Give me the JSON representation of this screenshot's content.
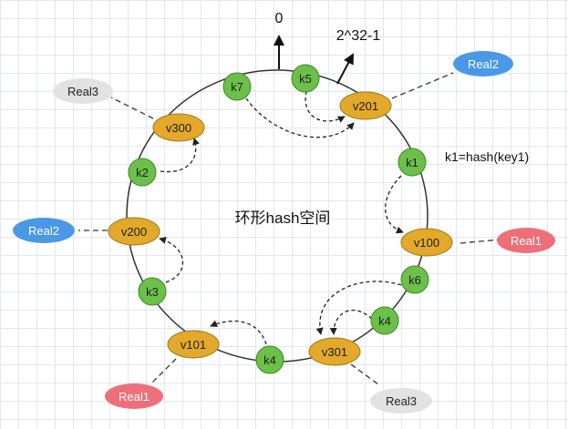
{
  "colors": {
    "key_fill": "#6cc04a",
    "key_stroke": "#3c8a22",
    "vnode_fill": "#e3a92a",
    "vnode_stroke": "#a4761a",
    "real_blue": "#4a98e6",
    "real_red": "#ee6f79",
    "real_gray": "#e2e2e2",
    "ring": "#333333"
  },
  "labels": {
    "zero": "0",
    "max": "2^32-1",
    "center": "环形hash空间",
    "annotation": "k1=hash(key1)"
  },
  "keys": {
    "k7": "k7",
    "k5": "k5",
    "k2": "k2",
    "k1": "k1",
    "k6": "k6",
    "k3": "k3",
    "k4a": "k4",
    "k4b": "k4"
  },
  "virtual_nodes": {
    "v300": "v300",
    "v201": "v201",
    "v200": "v200",
    "v100": "v100",
    "v101": "v101",
    "v301": "v301"
  },
  "real_nodes": {
    "real3_top": "Real3",
    "real2_right": "Real2",
    "real2_left": "Real2",
    "real1_right": "Real1",
    "real1_bottom": "Real1",
    "real3_bottom": "Real3"
  }
}
